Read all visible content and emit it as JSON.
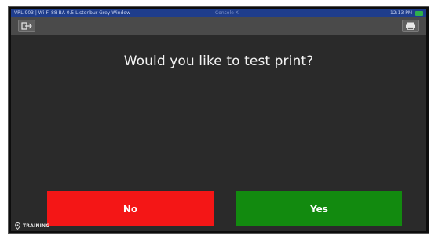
{
  "status_bar": {
    "left_text": "VRL 903 | Wi-Fi 88 BA 0.5 Listenbur Grey Window",
    "center_text": "Console X",
    "right_text": "12:13 PM",
    "indicator_color": "#2fb04a"
  },
  "toolbar": {
    "left_icon": "exit-icon",
    "right_icon": "printer-icon"
  },
  "dialog": {
    "prompt": "Would you like to test print?",
    "no_label": "No",
    "yes_label": "Yes",
    "no_color": "#f41616",
    "yes_color": "#128a0f"
  },
  "footer": {
    "mode_label": "TRAINING",
    "icon": "location-pin-icon"
  }
}
